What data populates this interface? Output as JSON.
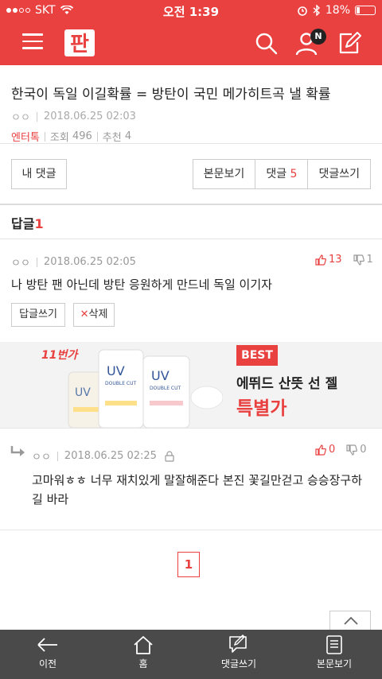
{
  "statusbar": {
    "carrier": "SKT",
    "time": "오전 1:39",
    "battery": "18%"
  },
  "appbar": {
    "logo_text": "판",
    "notification_badge": "N"
  },
  "article": {
    "title": "한국이 독일 이길확률 = 방탄이 국민 메가히트곡 낼 확률",
    "author": "ㅇㅇ",
    "date": "2018.06.25 02:03",
    "category": "엔터톡",
    "views_label": "조회",
    "views": "496",
    "recommend_label": "추천",
    "recommend": "4"
  },
  "actions": {
    "my_comments": "내 댓글",
    "view_post": "본문보기",
    "comments_label": "댓글",
    "comments_count": "5",
    "write_comment": "댓글쓰기"
  },
  "replies": {
    "label": "답글",
    "count": "1"
  },
  "comment": {
    "author": "ㅇㅇ",
    "date": "2018.06.25 02:05",
    "likes": "13",
    "dislikes": "1",
    "text": "나 방탄 팬 아닌데 방탄 응원하게 만드네 독일 이기자",
    "reply_button": "답글쓰기",
    "delete_button": "삭제"
  },
  "ad": {
    "brand": "11번가",
    "best": "BEST",
    "headline": "에뛰드 산뜻 선 젤",
    "subheadline": "특별가"
  },
  "nested_reply": {
    "author": "ㅇㅇ",
    "date": "2018.06.25 02:25",
    "likes": "0",
    "dislikes": "0",
    "text_line1": "고마워ㅎㅎ 너무 재치있게 말잘해준다 본진 꽃길만걷고 승승장구하",
    "text_line2": "길 바라"
  },
  "pagination": {
    "current": "1"
  },
  "toolbar": {
    "back": "이전",
    "home": "홈",
    "write": "댓글쓰기",
    "post": "본문보기"
  },
  "colors": {
    "accent": "#e94040",
    "toolbar": "#4a4a4a"
  },
  "battery_level": 0.18
}
